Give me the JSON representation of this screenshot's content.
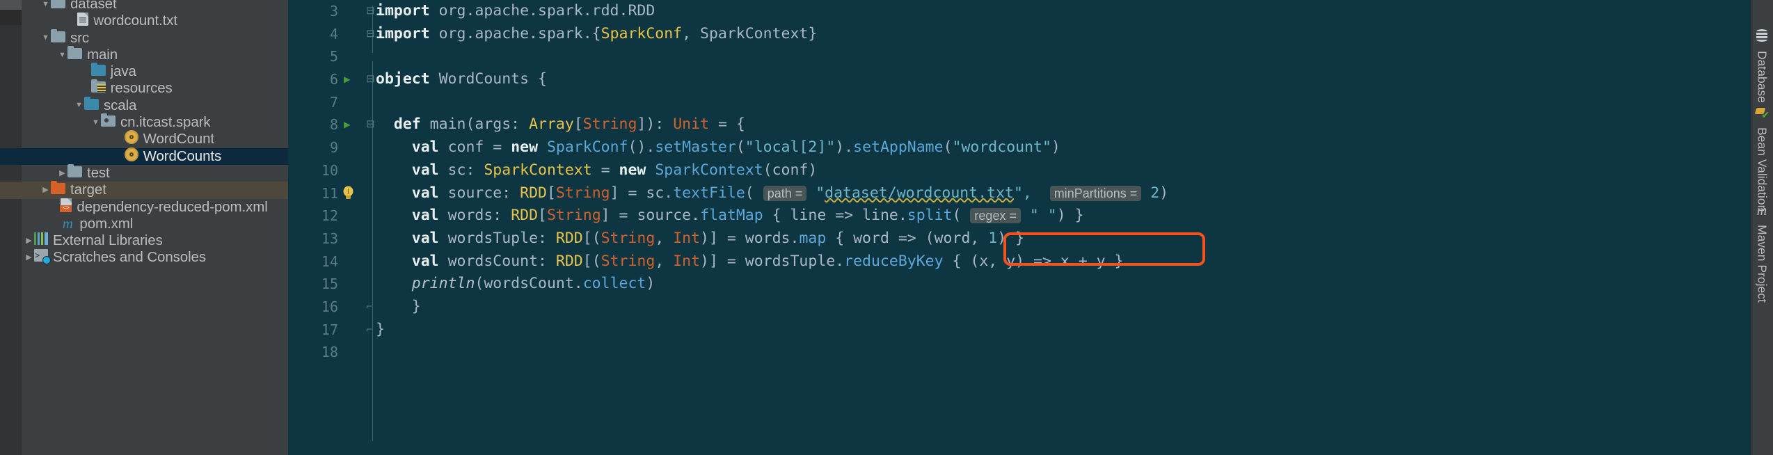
{
  "project_tree": {
    "items": [
      {
        "label": "dataset",
        "arrow": "down",
        "icon": "folder-icon",
        "indent": 1,
        "state": "normal"
      },
      {
        "label": "wordcount.txt",
        "arrow": "none",
        "icon": "text-file-icon",
        "indent": 2.6,
        "state": "normal"
      },
      {
        "label": "src",
        "arrow": "down",
        "icon": "folder-icon",
        "indent": 1,
        "state": "normal"
      },
      {
        "label": "main",
        "arrow": "down",
        "icon": "folder-icon",
        "indent": 2,
        "state": "normal"
      },
      {
        "label": "java",
        "arrow": "none",
        "icon": "source-folder-icon",
        "indent": 3.4,
        "state": "normal"
      },
      {
        "label": "resources",
        "arrow": "none",
        "icon": "resources-folder-icon",
        "indent": 3.4,
        "state": "normal"
      },
      {
        "label": "scala",
        "arrow": "down",
        "icon": "source-folder-icon",
        "indent": 3,
        "state": "normal"
      },
      {
        "label": "cn.itcast.spark",
        "arrow": "down",
        "icon": "package-icon",
        "indent": 4,
        "state": "normal"
      },
      {
        "label": "WordCount",
        "arrow": "none",
        "icon": "scala-object-icon",
        "indent": 5.4,
        "state": "normal"
      },
      {
        "label": "WordCounts",
        "arrow": "none",
        "icon": "scala-object-icon",
        "indent": 5.4,
        "state": "selected"
      },
      {
        "label": "test",
        "arrow": "right",
        "icon": "folder-icon",
        "indent": 2,
        "state": "normal"
      },
      {
        "label": "target",
        "arrow": "right",
        "icon": "target-folder-icon",
        "indent": 1,
        "state": "highlighted"
      },
      {
        "label": "dependency-reduced-pom.xml",
        "arrow": "none",
        "icon": "xml-file-icon",
        "indent": 1.6,
        "state": "normal"
      },
      {
        "label": "pom.xml",
        "arrow": "none",
        "icon": "maven-file-icon",
        "indent": 1.6,
        "state": "normal"
      },
      {
        "label": "External Libraries",
        "arrow": "right",
        "icon": "external-libraries-icon",
        "indent": 0,
        "state": "normal"
      },
      {
        "label": "Scratches and Consoles",
        "arrow": "right",
        "icon": "scratches-icon",
        "indent": 0,
        "state": "normal"
      }
    ]
  },
  "editor": {
    "filename": "WordCounts",
    "lines": [
      {
        "num": "3",
        "fold": "minus",
        "run": false,
        "bulb": false
      },
      {
        "num": "4",
        "fold": "minus2",
        "run": false,
        "bulb": false
      },
      {
        "num": "5",
        "fold": "",
        "run": false,
        "bulb": false
      },
      {
        "num": "6",
        "fold": "minus",
        "run": true,
        "bulb": false
      },
      {
        "num": "7",
        "fold": "",
        "run": false,
        "bulb": false
      },
      {
        "num": "8",
        "fold": "minus",
        "run": true,
        "bulb": false
      },
      {
        "num": "9",
        "fold": "",
        "run": false,
        "bulb": false
      },
      {
        "num": "10",
        "fold": "",
        "run": false,
        "bulb": false
      },
      {
        "num": "11",
        "fold": "",
        "run": false,
        "bulb": true
      },
      {
        "num": "12",
        "fold": "",
        "run": false,
        "bulb": false
      },
      {
        "num": "13",
        "fold": "",
        "run": false,
        "bulb": false
      },
      {
        "num": "14",
        "fold": "",
        "run": false,
        "bulb": false
      },
      {
        "num": "15",
        "fold": "",
        "run": false,
        "bulb": false
      },
      {
        "num": "16",
        "fold": "end",
        "run": false,
        "bulb": false
      },
      {
        "num": "17",
        "fold": "end",
        "run": false,
        "bulb": false
      },
      {
        "num": "18",
        "fold": "",
        "run": false,
        "bulb": false
      }
    ],
    "code": {
      "l3_kw": "import",
      "l3_rest": " org.apache.spark.rdd.RDD",
      "l4_kw": "import",
      "l4_a": " org.apache.spark.",
      "l4_brace1": "{",
      "l4_sparkconf": "SparkConf",
      "l4_comma": ", ",
      "l4_sparkcontext": "SparkContext",
      "l4_brace2": "}",
      "l6_kw": "object",
      "l6_name": " WordCounts {",
      "l8_indent": "  ",
      "l8_def": "def",
      "l8_main": " main(args: ",
      "l8_array": "Array",
      "l8_lb": "[",
      "l8_string": "String",
      "l8_rb": "]",
      "l8_colon": "): ",
      "l8_unit": "Unit",
      "l8_eq": " = {",
      "l9_val": "val",
      "l9_conf": " conf = ",
      "l9_new": "new",
      "l9_sparkconf": " SparkConf",
      "l9_p1": "().",
      "l9_setmaster": "setMaster",
      "l9_p2": "(",
      "l9_local": "\"local[2]\"",
      "l9_p3": ").",
      "l9_setappname": "setAppName",
      "l9_p4": "(",
      "l9_wc": "\"wordcount\"",
      "l9_p5": ")",
      "l10_val": "val",
      "l10_sc": " sc: ",
      "l10_type": "SparkContext",
      "l10_eq": " = ",
      "l10_new": "new",
      "l10_ctx": " SparkContext",
      "l10_args": "(conf)",
      "l11_val": "val",
      "l11_src": " source: ",
      "l11_rdd": "RDD",
      "l11_lb": "[",
      "l11_string": "String",
      "l11_rb": "]",
      "l11_eq": " = sc.",
      "l11_textfile": "textFile",
      "l11_paren": "(",
      "l11_hint_path": "path =",
      "l11_pathstr_q1": "\"",
      "l11_pathstr": "dataset/wordcount.txt",
      "l11_pathstr_q2": "\",",
      "l11_hint_minpart": "minPartitions =",
      "l11_num": "2",
      "l11_close": ")",
      "l12_val": "val",
      "l12_words": " words: ",
      "l12_rdd": "RDD",
      "l12_lb": "[",
      "l12_string": "String",
      "l12_rb": "]",
      "l12_eq": " = source.",
      "l12_flatmap": "flatMap",
      "l12_body": " { line => line.",
      "l12_split": "split",
      "l12_p": "(",
      "l12_hint_regex": "regex =",
      "l12_sep": "\" \"",
      "l12_end": ") }",
      "l13_val": "val",
      "l13_wt": " wordsTuple: ",
      "l13_rdd": "RDD",
      "l13_lb": "[(",
      "l13_string": "String",
      "l13_comma": ", ",
      "l13_int": "Int",
      "l13_rb": ")]",
      "l13_eq": " = words.",
      "l13_map": "map",
      "l13_body": " { word => (word, ",
      "l13_one": "1",
      "l13_end": ") }",
      "l14_val": "val",
      "l14_wc": " wordsCount: ",
      "l14_rdd": "RDD",
      "l14_lb": "[(",
      "l14_string": "String",
      "l14_comma": ", ",
      "l14_int": "Int",
      "l14_rb": ")]",
      "l14_eq": " = wordsTuple.",
      "l14_reduce": "reduceByKey",
      "l14_body": " { (x, y) => x + y }",
      "l15_println": "println",
      "l15_body": "(wordsCount.",
      "l15_collect": "collect",
      "l15_end": ")",
      "l16_close": "}",
      "l17_close": "}"
    }
  },
  "right_toolbar": {
    "tools": [
      {
        "label": "Database",
        "icon": "database-icon"
      },
      {
        "label": "Bean Validation",
        "icon": "bean-validation-icon"
      },
      {
        "label": "Maven Project",
        "icon": "maven-icon"
      }
    ]
  },
  "colors": {
    "editor_bg": "#0d3642",
    "panel_bg": "#3c3f41",
    "selection": "#0d293e",
    "annotation": "#f4511e",
    "keyword": "#e8f0f2",
    "string": "#6fb7c9",
    "type": "#e8c34a"
  }
}
